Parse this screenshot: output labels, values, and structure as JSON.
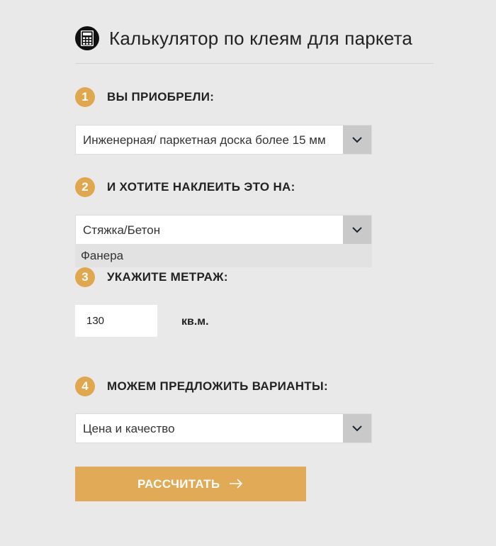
{
  "header": {
    "title": "Калькулятор по клеям для паркета",
    "icon": "calculator-icon"
  },
  "steps": [
    {
      "number": "1",
      "label": "ВЫ ПРИОБРЕЛИ:"
    },
    {
      "number": "2",
      "label": "И ХОТИТЕ НАКЛЕИТЬ ЭТО НА:"
    },
    {
      "number": "3",
      "label": "УКАЖИТЕ МЕТРАЖ:"
    },
    {
      "number": "4",
      "label": "МОЖЕМ ПРЕДЛОЖИТЬ ВАРИАНТЫ:"
    }
  ],
  "selects": {
    "material": {
      "value": "Инженерная/ паркетная доска более 15 мм"
    },
    "surface": {
      "value": "Стяжка/Бетон",
      "options": [
        "Фанера"
      ]
    },
    "variant": {
      "value": "Цена и качество"
    }
  },
  "area": {
    "value": "130",
    "unit": "кв.м."
  },
  "submit": {
    "label": "РАССЧИТАТЬ",
    "icon": "arrow-right-icon"
  },
  "colors": {
    "accent": "#e0a74e",
    "button": "#e0aa56",
    "background": "#e9e9e9"
  }
}
